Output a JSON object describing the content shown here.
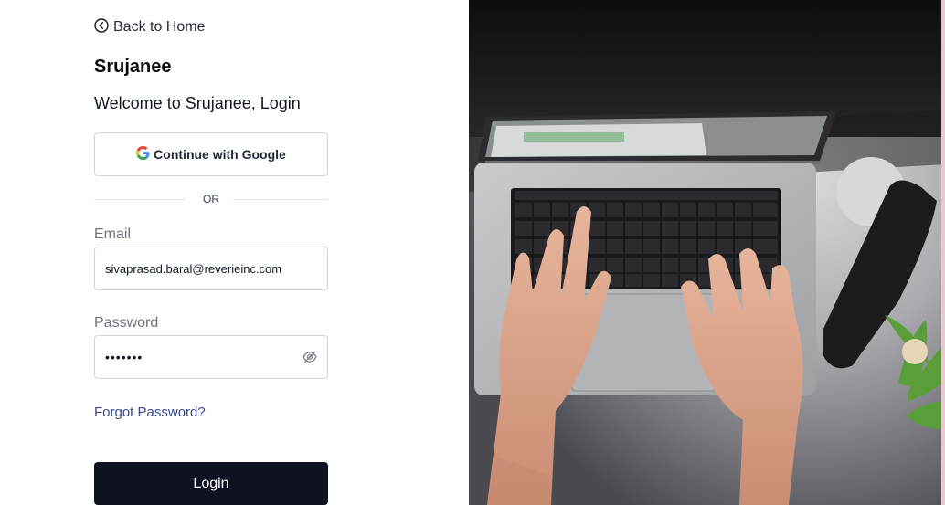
{
  "nav": {
    "back_label": "Back to Home"
  },
  "brand": {
    "name": "Srujanee"
  },
  "heading": {
    "welcome": "Welcome to Srujanee, Login"
  },
  "google": {
    "label": "Continue with Google"
  },
  "divider": {
    "text": "OR"
  },
  "form": {
    "email_label": "Email",
    "email_value": "sivaprasad.baral@reverieinc.com",
    "password_label": "Password",
    "password_value": "•••••••",
    "forgot_label": "Forgot Password?",
    "login_label": "Login"
  },
  "colors": {
    "primary_button": "#0f1220",
    "link": "#3b4a8c",
    "border": "#d1d5db"
  },
  "icons": {
    "back": "chevron-left-circle-icon",
    "google": "google-icon",
    "password_toggle": "eye-off-icon"
  }
}
